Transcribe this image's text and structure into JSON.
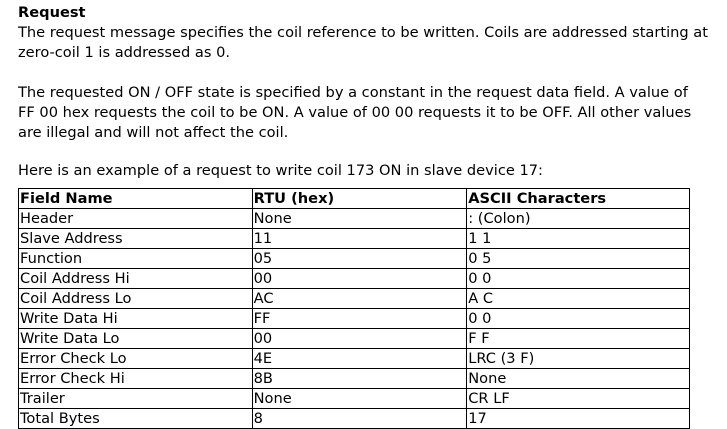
{
  "section": {
    "heading": "Request",
    "paragraphs": [
      "The request message specifies the coil reference to be written. Coils are addressed starting at zero-coil 1 is addressed as 0.",
      "The requested ON / OFF state is specified by a constant in the request data field. A value of FF 00 hex requests the coil to be ON. A value of 00 00 requests it to be OFF. All other values are illegal and will not affect the coil.",
      "Here is an example of a request to write coil 173 ON in slave device 17:"
    ]
  },
  "table": {
    "headers": [
      "Field Name",
      "RTU (hex)",
      "ASCII Characters"
    ],
    "rows": [
      [
        "Header",
        "None",
        ": (Colon)"
      ],
      [
        "Slave Address",
        "11",
        "1 1"
      ],
      [
        "Function",
        "05",
        "0 5"
      ],
      [
        "Coil Address Hi",
        "00",
        "0 0"
      ],
      [
        "Coil Address Lo",
        "AC",
        "A C"
      ],
      [
        "Write Data Hi",
        "FF",
        "0 0"
      ],
      [
        "Write Data Lo",
        "00",
        "F F"
      ],
      [
        "Error Check Lo",
        "4E",
        "LRC (3 F)"
      ],
      [
        "Error Check Hi",
        "8B",
        "None"
      ],
      [
        "Trailer",
        "None",
        "CR LF"
      ],
      [
        "Total Bytes",
        "8",
        "17"
      ]
    ]
  }
}
